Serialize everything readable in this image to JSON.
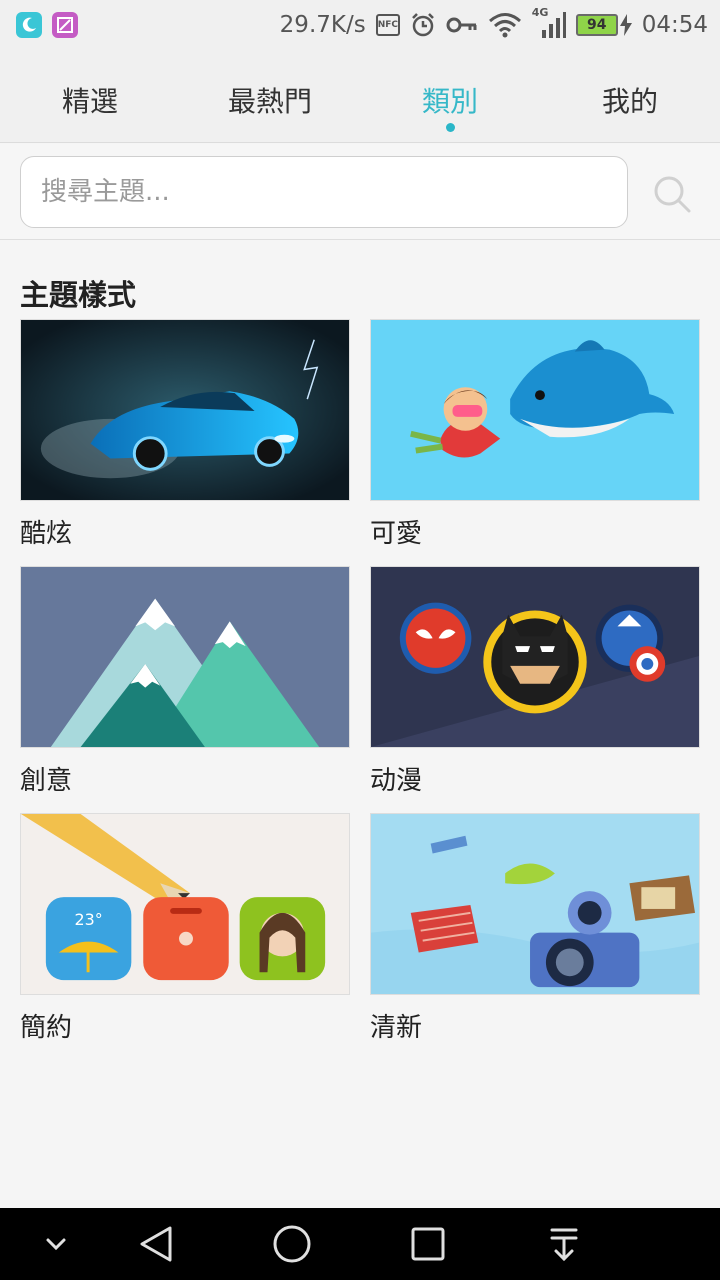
{
  "status_bar": {
    "net_speed": "29.7K/s",
    "nfc_label": "NFC",
    "network_type": "4G",
    "battery_level": "94",
    "time": "04:54",
    "icons": [
      "moon-app-icon",
      "image-app-icon",
      "nfc-icon",
      "alarm-icon",
      "key-icon",
      "wifi-icon",
      "cell-signal-icon",
      "battery-icon",
      "charging-icon"
    ]
  },
  "tabs": [
    {
      "label": "精選",
      "active": false
    },
    {
      "label": "最熱門",
      "active": false
    },
    {
      "label": "類別",
      "active": true
    },
    {
      "label": "我的",
      "active": false
    }
  ],
  "search": {
    "placeholder": "搜尋主題...",
    "value": "",
    "icon": "search-icon"
  },
  "section": {
    "title": "主題樣式"
  },
  "categories": [
    {
      "label": "酷炫",
      "thumb": "sports-car"
    },
    {
      "label": "可愛",
      "thumb": "diver-dolphin"
    },
    {
      "label": "創意",
      "thumb": "mountains"
    },
    {
      "label": "动漫",
      "thumb": "superheroes"
    },
    {
      "label": "簡約",
      "thumb": "pencil-apps"
    },
    {
      "label": "清新",
      "thumb": "floating-objects"
    }
  ],
  "thumb_weather_temp": "23°",
  "nav_bar": [
    "collapse-chevron-icon",
    "back-triangle-icon",
    "home-circle-icon",
    "recents-square-icon",
    "notification-pull-icon"
  ],
  "colors": {
    "accent": "#2ab6c8",
    "background": "#f5f5f5",
    "nav_bar": "#000000"
  }
}
